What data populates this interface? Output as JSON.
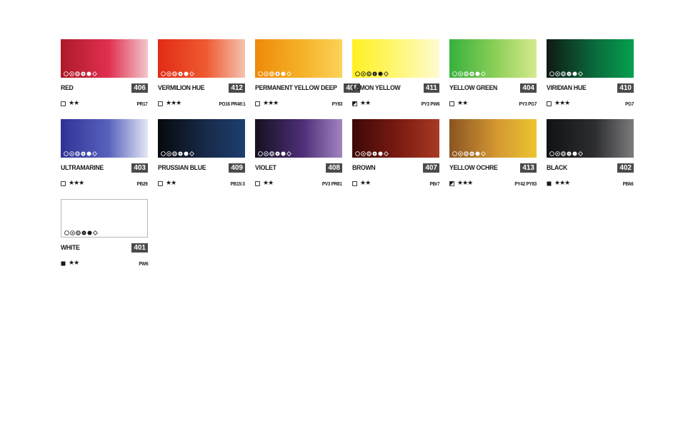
{
  "colors": [
    {
      "name": "RED",
      "number": "406",
      "stars": "★★",
      "transparency": "transparent",
      "pigment": "PR17",
      "gradient": [
        "#ad1a28",
        "#e03051",
        "#f2c6cd"
      ],
      "light": false,
      "props_dark": false
    },
    {
      "name": "VERMILION HUE",
      "number": "412",
      "stars": "★★★",
      "transparency": "transparent",
      "pigment": "PO16 PR48:1",
      "gradient": [
        "#e22b16",
        "#ee5a30",
        "#f4c2b0"
      ],
      "light": false,
      "props_dark": false
    },
    {
      "name": "PERMANENT YELLOW DEEP",
      "number": "405",
      "stars": "★★★",
      "transparency": "transparent",
      "pigment": "PY83",
      "gradient": [
        "#ee8a0a",
        "#f5b22a",
        "#fbd258"
      ],
      "light": false,
      "props_dark": false
    },
    {
      "name": "LEMON YELLOW",
      "number": "411",
      "stars": "★★",
      "transparency": "semi-transparent",
      "pigment": "PY3 PW6",
      "gradient": [
        "#fff021",
        "#fff77a",
        "#fffbd2"
      ],
      "light": false,
      "props_dark": true
    },
    {
      "name": "YELLOW GREEN",
      "number": "404",
      "stars": "★★",
      "transparency": "transparent",
      "pigment": "PY3 PG7",
      "gradient": [
        "#36b13d",
        "#8fd05a",
        "#d6ea8e"
      ],
      "light": false,
      "props_dark": false
    },
    {
      "name": "VIRIDIAN HUE",
      "number": "410",
      "stars": "★★★",
      "transparency": "transparent",
      "pigment": "PG7",
      "gradient": [
        "#0f1a14",
        "#0a6a3c",
        "#06a050"
      ],
      "light": false,
      "props_dark": false
    },
    {
      "name": "ULTRAMARINE",
      "number": "403",
      "stars": "★★★",
      "transparency": "transparent",
      "pigment": "PB29",
      "gradient": [
        "#2f3295",
        "#5862bd",
        "#e3e7f5"
      ],
      "light": false,
      "props_dark": false
    },
    {
      "name": "PRUSSIAN BLUE",
      "number": "409",
      "stars": "★★",
      "transparency": "transparent",
      "pigment": "PB15:3",
      "gradient": [
        "#07090d",
        "#172a48",
        "#1d3f70"
      ],
      "light": false,
      "props_dark": false
    },
    {
      "name": "VIOLET",
      "number": "408",
      "stars": "★★",
      "transparency": "transparent",
      "pigment": "PV3 PR81",
      "gradient": [
        "#15101f",
        "#4d2f78",
        "#a384c0"
      ],
      "light": false,
      "props_dark": false
    },
    {
      "name": "BROWN",
      "number": "407",
      "stars": "★★",
      "transparency": "transparent",
      "pigment": "PBr7",
      "gradient": [
        "#3d0807",
        "#7c1c12",
        "#a83a24"
      ],
      "light": false,
      "props_dark": false
    },
    {
      "name": "YELLOW OCHRE",
      "number": "413",
      "stars": "★★★",
      "transparency": "semi-transparent",
      "pigment": "PY42 PY83",
      "gradient": [
        "#8a5422",
        "#d59832",
        "#ebc430"
      ],
      "light": false,
      "props_dark": false
    },
    {
      "name": "BLACK",
      "number": "402",
      "stars": "★★★",
      "transparency": "opaque",
      "pigment": "PBk6",
      "gradient": [
        "#111214",
        "#2c2d30",
        "#7c7c7e"
      ],
      "light": false,
      "props_dark": false
    },
    {
      "name": "WHITE",
      "number": "401",
      "stars": "★★",
      "transparency": "opaque",
      "pigment": "PW6",
      "gradient": [
        "#ffffff",
        "#ffffff",
        "#ffffff"
      ],
      "light": true,
      "props_dark": true
    }
  ],
  "icons": [
    "circle-outline-icon",
    "circle-dot-icon",
    "circle-target-icon",
    "circle-cross-icon",
    "filled-circle-icon",
    "diamond-icon",
    "transparent-square-icon",
    "semi-transparent-square-icon",
    "opaque-square-icon",
    "star-icon"
  ]
}
